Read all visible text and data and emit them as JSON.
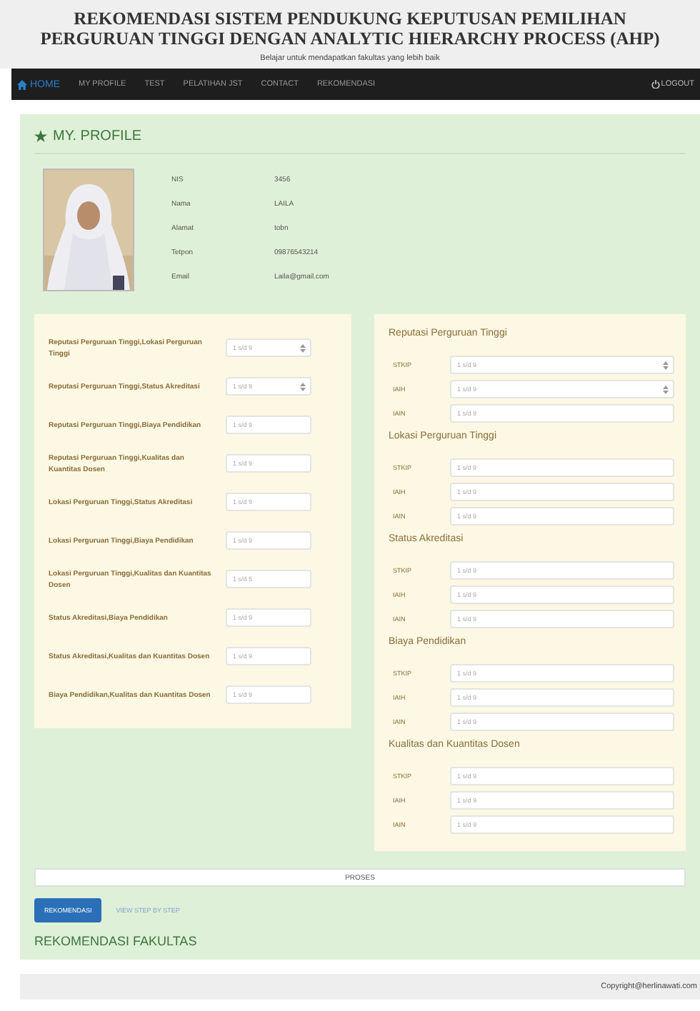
{
  "header": {
    "title": "REKOMENDASI SISTEM PENDUKUNG KEPUTUSAN PEMILIHAN PERGURUAN TINGGI DENGAN ANALYTIC HIERARCHY PROCESS (AHP)",
    "subtitle": "Belajar untuk mendapatkan fakultas yang lebih baik"
  },
  "nav": {
    "items": [
      {
        "label": "HOME",
        "selected": true
      },
      {
        "label": "MY PROFILE",
        "selected": false
      },
      {
        "label": "TEST",
        "selected": false
      },
      {
        "label": "PELATIHAN JST",
        "selected": false
      },
      {
        "label": "CONTACT",
        "selected": false
      },
      {
        "label": "REKOMENDASI",
        "selected": false
      }
    ],
    "logout": "LOGOUT"
  },
  "profile": {
    "heading": "MY. PROFILE",
    "fields": [
      {
        "label": "NIS",
        "value": "3456"
      },
      {
        "label": "Nama",
        "value": "LAILA"
      },
      {
        "label": "Alamat",
        "value": "tobn"
      },
      {
        "label": "Tetpon",
        "value": "09876543214"
      },
      {
        "label": "Email",
        "value": "Laila@gmail.com"
      }
    ]
  },
  "criteria": [
    {
      "label": "Reputasi Perguruan Tinggi,Lokasi Perguruan Tinggi",
      "placeholder": "1 s/d 9",
      "kind": "spinner"
    },
    {
      "label": "Reputasi Perguruan Tinggi,Status Akreditasi",
      "placeholder": "1 s/d 9",
      "kind": "spinner"
    },
    {
      "label": "Reputasi Perguruan Tinggi,Biaya Pendidikan",
      "placeholder": "1 s/d 9",
      "kind": "text"
    },
    {
      "label": "Reputasi Perguruan Tinggi,Kualitas dan Kuantitas Dosen",
      "placeholder": "1 s/d 9",
      "kind": "text"
    },
    {
      "label": "Lokasi Perguruan Tinggi,Status Akreditasi",
      "placeholder": "1 s/d 9",
      "kind": "text"
    },
    {
      "label": "Lokasi Perguruan Tinggi,Biaya Pendidikan",
      "placeholder": "1 s/d 9",
      "kind": "text"
    },
    {
      "label": "Lokasi Perguruan Tinggi,Kualitas dan Kuantitas Dosen",
      "placeholder": "1 s/d 5",
      "kind": "text"
    },
    {
      "label": "Status Akreditasi,Biaya Pendidikan",
      "placeholder": "1 s/d 9",
      "kind": "text"
    },
    {
      "label": "Status Akreditasi,Kualitas dan Kuantitas Dosen",
      "placeholder": "1 s/d 9",
      "kind": "text"
    },
    {
      "label": "Biaya Pendidikan,Kualitas dan Kuantitas Dosen",
      "placeholder": "1 s/d 9",
      "kind": "text"
    }
  ],
  "alternatives": [
    {
      "title": "Reputasi Perguruan Tinggi",
      "rows": [
        {
          "label": "STKIP",
          "placeholder": "1 s/d 9",
          "kind": "spinner"
        },
        {
          "label": "IAIH",
          "placeholder": "1 s/d 9",
          "kind": "spinner"
        },
        {
          "label": "IAIN",
          "placeholder": "1 s/d 9",
          "kind": "text"
        }
      ]
    },
    {
      "title": "Lokasi Perguruan Tinggi",
      "rows": [
        {
          "label": "STKIP",
          "placeholder": "1 s/d 9",
          "kind": "text"
        },
        {
          "label": "IAIH",
          "placeholder": "1 s/d 9",
          "kind": "text"
        },
        {
          "label": "IAIN",
          "placeholder": "1 s/d 9",
          "kind": "text"
        }
      ]
    },
    {
      "title": "Status Akreditasi",
      "rows": [
        {
          "label": "STKIP",
          "placeholder": "1 s/d 9",
          "kind": "text"
        },
        {
          "label": "IAIH",
          "placeholder": "1 s/d 9",
          "kind": "text"
        },
        {
          "label": "IAIN",
          "placeholder": "1 s/d 9",
          "kind": "text"
        }
      ]
    },
    {
      "title": "Biaya Pendidikan",
      "rows": [
        {
          "label": "STKIP",
          "placeholder": "1 s/d 9",
          "kind": "text"
        },
        {
          "label": "IAIH",
          "placeholder": "1 s/d 9",
          "kind": "text"
        },
        {
          "label": "IAIN",
          "placeholder": "1 s/d 9",
          "kind": "text"
        }
      ]
    },
    {
      "title": "Kualitas dan Kuantitas Dosen",
      "rows": [
        {
          "label": "STKIP",
          "placeholder": "1 s/d 9",
          "kind": "text"
        },
        {
          "label": "IAIH",
          "placeholder": "1 s/d 9",
          "kind": "text"
        },
        {
          "label": "IAIN",
          "placeholder": "1 s/d 9",
          "kind": "text"
        }
      ]
    }
  ],
  "proses": "PROSES",
  "actions": {
    "primary": "REKOMENDASI",
    "link": "VIEW STEP BY STEP"
  },
  "result_heading": "REKOMENDASI FAKULTAS",
  "footer": "Copyright@herlinawati.com"
}
